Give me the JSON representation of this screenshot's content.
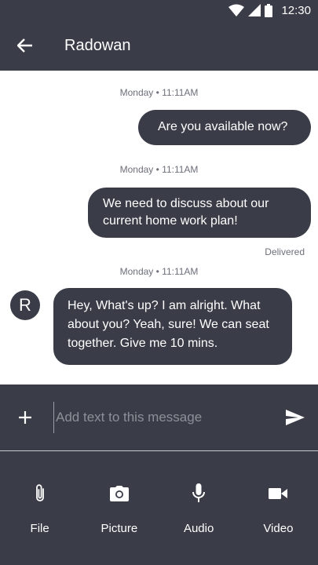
{
  "status_bar": {
    "time": "12:30"
  },
  "header": {
    "title": "Radowan"
  },
  "messages": [
    {
      "timestamp": "Monday • 11:11AM",
      "direction": "out",
      "text": "Are you available now?"
    },
    {
      "timestamp": "Monday • 11:11AM",
      "direction": "out",
      "text": "We need to discuss about our current home work plan!",
      "status": "Delivered"
    },
    {
      "timestamp": "Monday • 11:11AM",
      "direction": "in",
      "avatar_initial": "R",
      "text": "Hey, What's up? I am alright. What about you? Yeah, sure! We can seat together. Give me 10 mins."
    }
  ],
  "composer": {
    "placeholder": "Add text to this message",
    "value": ""
  },
  "attachments": [
    {
      "label": "File",
      "icon": "paperclip-icon"
    },
    {
      "label": "Picture",
      "icon": "camera-icon"
    },
    {
      "label": "Audio",
      "icon": "microphone-icon"
    },
    {
      "label": "Video",
      "icon": "videocam-icon"
    }
  ],
  "colors": {
    "primary_dark": "#3a3c47",
    "background": "#ffffff",
    "text_muted": "#6d6f7a"
  }
}
